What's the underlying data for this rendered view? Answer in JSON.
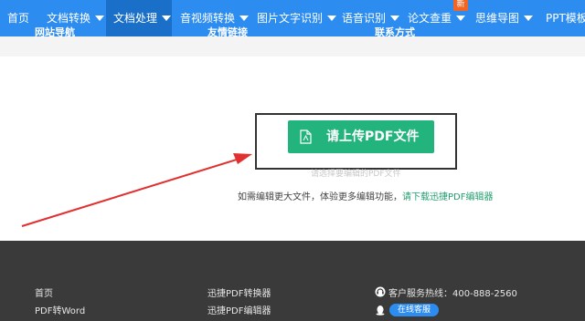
{
  "nav": {
    "items": [
      {
        "label": "首页"
      },
      {
        "label": "文档转换"
      },
      {
        "label": "文档处理"
      },
      {
        "label": "音视频转换"
      },
      {
        "label": "图片文字识别"
      },
      {
        "label": "语音识别"
      },
      {
        "label": "论文查重"
      },
      {
        "label": "思维导图"
      },
      {
        "label": "PPT模板"
      }
    ],
    "new_badge": "新"
  },
  "upload": {
    "button_label": "请上传PDF文件",
    "hint": "请选择要编辑的PDF文件"
  },
  "promo": {
    "text": "如需编辑更大文件，体验更多编辑功能，",
    "link": "请下载迅捷PDF编辑器"
  },
  "footer": {
    "site_nav": {
      "title": "网站导航",
      "items": [
        "首页",
        "PDF转Word"
      ]
    },
    "links": {
      "title": "友情链接",
      "items": [
        "迅捷PDF转换器",
        "迅捷PDF编辑器"
      ]
    },
    "contact": {
      "title": "联系方式",
      "hotline": "客户服务热线：400-888-2560",
      "online_service": "在线客服"
    }
  },
  "colors": {
    "nav": "#2d8cf0",
    "nav_active": "#1a6fc8",
    "upload_button": "#23b37c",
    "arrow": "#e03030",
    "footer": "#3a3a3a",
    "badge": "#f26522"
  }
}
